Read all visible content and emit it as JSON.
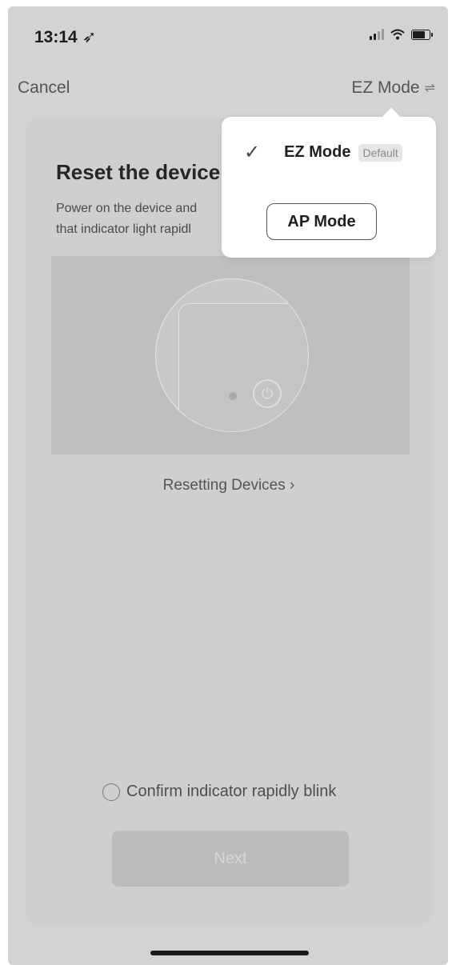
{
  "status_bar": {
    "time": "13:14",
    "location_icon": "location-arrow-icon",
    "signal_icon": "signal-icon",
    "wifi_icon": "wifi-icon",
    "battery_icon": "battery-icon"
  },
  "nav": {
    "cancel_label": "Cancel",
    "mode_label": "EZ Mode",
    "mode_icon": "swap-icon"
  },
  "content": {
    "title": "Reset the device",
    "description_line1": "Power on the device and",
    "description_line2": "that indicator light rapidl",
    "reset_link": "Resetting Devices ›",
    "confirm_label": "Confirm indicator rapidly blink",
    "confirm_checked": false,
    "next_button": "Next"
  },
  "mode_popup": {
    "ez_mode_label": "EZ Mode",
    "ez_mode_selected": true,
    "default_badge": "Default",
    "ap_mode_label": "AP Mode"
  },
  "colors": {
    "overlay_bg": "#d3d3d3",
    "popup_bg": "#ffffff",
    "text_dark": "#1f1f1f"
  }
}
